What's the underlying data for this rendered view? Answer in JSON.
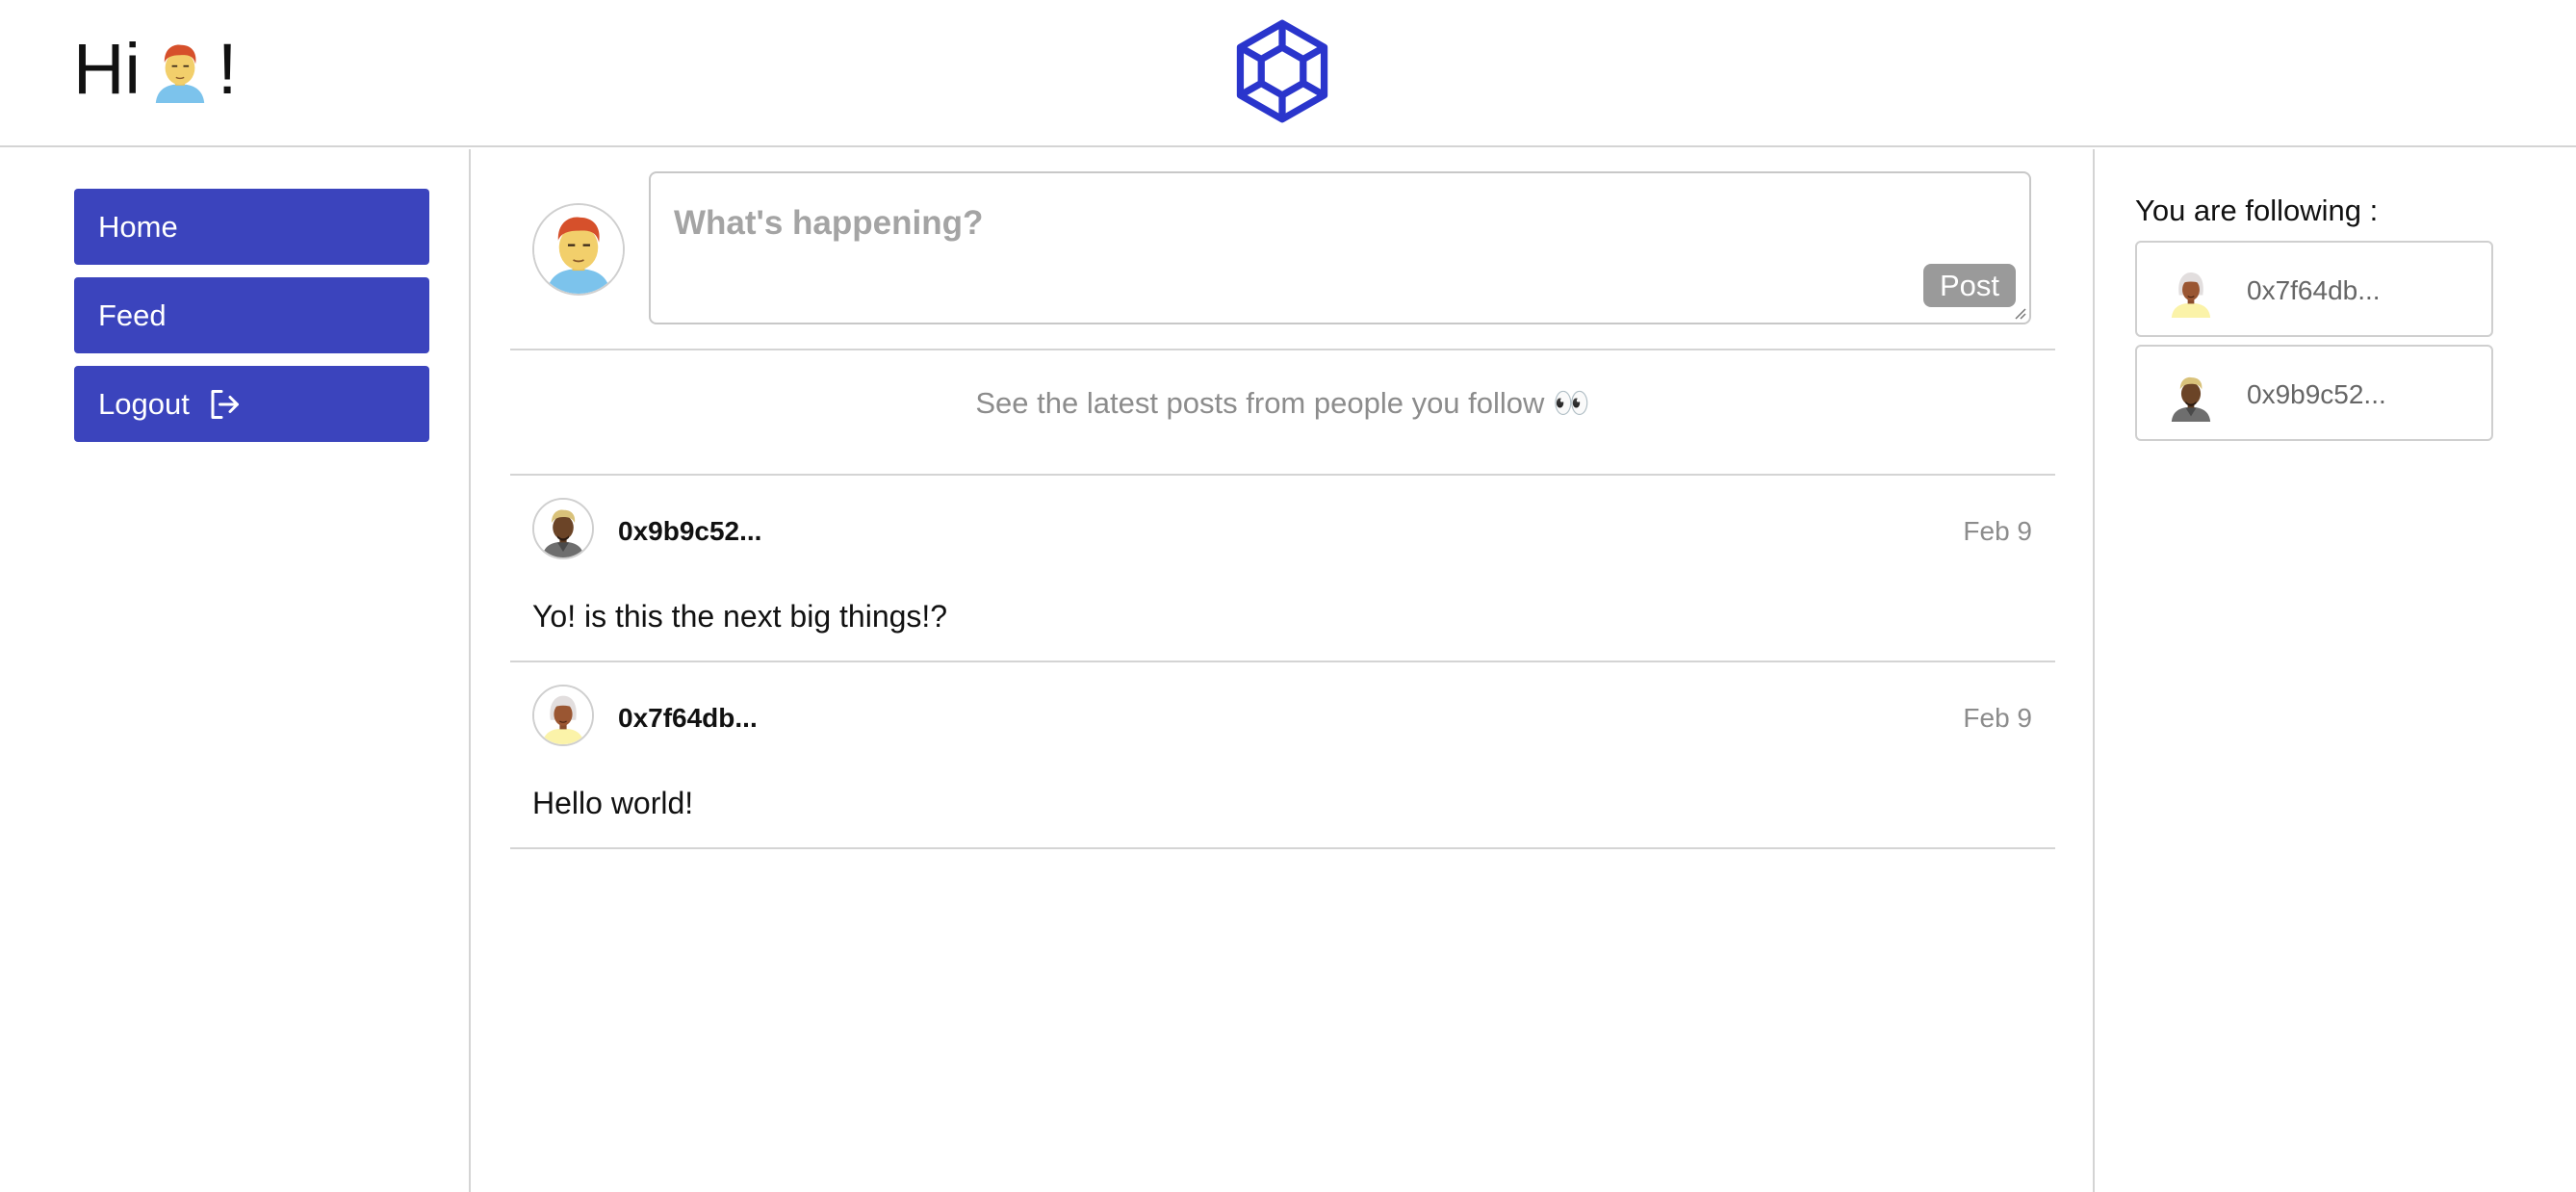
{
  "header": {
    "greeting_prefix": "Hi",
    "greeting_suffix": "!",
    "logo_icon": "hexagon-knot-logo",
    "brand_color": "#2a35cc"
  },
  "sidebar": {
    "items": [
      {
        "label": "Home",
        "icon": ""
      },
      {
        "label": "Feed",
        "icon": ""
      },
      {
        "label": "Logout",
        "icon": "logout-icon"
      }
    ],
    "button_color": "#3b44bd"
  },
  "compose": {
    "placeholder": "What's happening?",
    "post_label": "Post"
  },
  "feed": {
    "hint": "See the latest posts from people you follow 👀",
    "posts": [
      {
        "author": "0x9b9c52...",
        "date": "Feb 9",
        "text": "Yo! is this the next big things!?"
      },
      {
        "author": "0x7f64db...",
        "date": "Feb 9",
        "text": "Hello world!"
      }
    ]
  },
  "following": {
    "title": "You are following :",
    "users": [
      {
        "name": "0x7f64db..."
      },
      {
        "name": "0x9b9c52..."
      }
    ]
  }
}
